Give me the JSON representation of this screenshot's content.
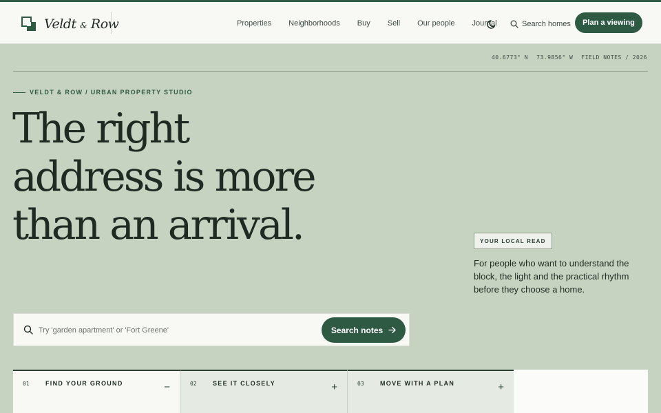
{
  "brand": {
    "name_first": "Veldt",
    "name_amp": "&",
    "name_last": "Row",
    "accent_color": "#2e5a44",
    "background_color": "#c6d3c0"
  },
  "nav": {
    "links": [
      "Properties",
      "Neighborhoods",
      "Buy",
      "Sell",
      "Our people",
      "Journal"
    ],
    "theme_icon": "moon-icon",
    "search_label": "Search homes",
    "cta_label": "Plan a viewing"
  },
  "meta": {
    "latitude": "40.6773° N",
    "longitude": "73.9856° W",
    "field_notes": "FIELD NOTES / 2026"
  },
  "hero": {
    "eyebrow": "VELDT & ROW / URBAN PROPERTY STUDIO",
    "headline": "The right address is more than an arrival.",
    "tag": "YOUR LOCAL READ",
    "description": "For people who want to understand the block, the light and the practical rhythm before they choose a home."
  },
  "search": {
    "placeholder": "Try 'garden apartment' or 'Fort Greene'",
    "value": "",
    "button_label": "Search notes"
  },
  "steps": [
    {
      "number": "01",
      "title": "FIND YOUR GROUND",
      "toggle": "−",
      "expanded": true
    },
    {
      "number": "02",
      "title": "SEE IT CLOSELY",
      "toggle": "+",
      "expanded": false
    },
    {
      "number": "03",
      "title": "MOVE WITH A PLAN",
      "toggle": "+",
      "expanded": false
    }
  ]
}
